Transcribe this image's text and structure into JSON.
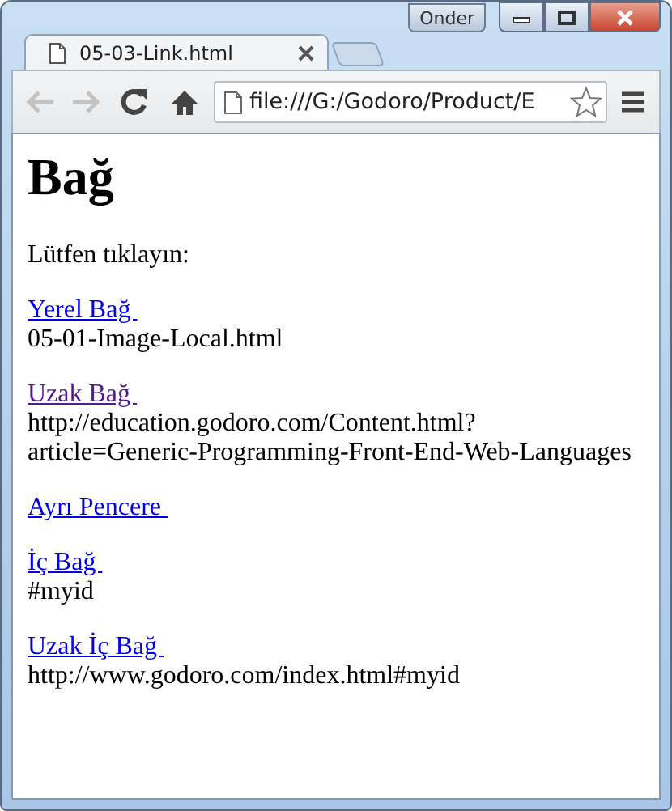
{
  "window": {
    "profile_button": "Onder"
  },
  "tabs": [
    {
      "title": "05-03-Link.html",
      "selected": true
    }
  ],
  "toolbar": {
    "address": "file:///G:/Godoro/Product/E",
    "back_disabled": true,
    "forward_disabled": true
  },
  "page": {
    "heading": "Bağ",
    "intro": "Lütfen tıklayın:",
    "links": [
      {
        "label": "Yerel Bağ ",
        "visited": false,
        "target": "05-01-Image-Local.html"
      },
      {
        "label": "Uzak Bağ ",
        "visited": true,
        "target": "http://education.godoro.com/Content.html?article=Generic-Programming-Front-End-Web-Languages"
      },
      {
        "label": "Ayrı Pencere ",
        "visited": false
      },
      {
        "label": "İç Bağ ",
        "visited": false,
        "target": "#myid"
      },
      {
        "label": "Uzak İç Bağ ",
        "visited": false,
        "target": "http://www.godoro.com/index.html#myid"
      }
    ]
  }
}
